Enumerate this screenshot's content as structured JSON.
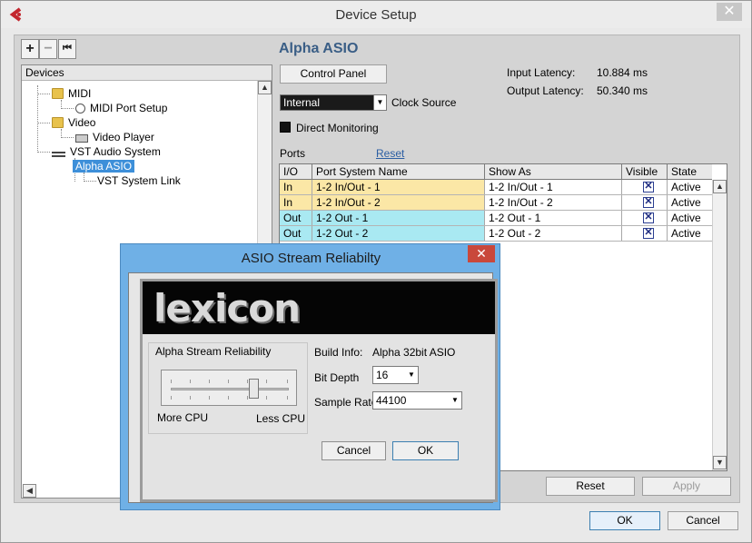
{
  "window": {
    "title": "Device Setup",
    "close_glyph": "✕"
  },
  "toolbar": {
    "add": "+",
    "remove": "−",
    "reset": "⏮"
  },
  "tree": {
    "header": "Devices",
    "items": [
      "MIDI",
      "MIDI Port Setup",
      "Video",
      "Video Player",
      "VST Audio System",
      "Alpha ASIO",
      "VST System Link"
    ]
  },
  "panel": {
    "title": "Alpha ASIO",
    "control_panel": "Control Panel",
    "clock_value": "Internal",
    "clock_label": "Clock Source",
    "direct_monitoring": "Direct Monitoring",
    "input_latency_label": "Input Latency:",
    "input_latency_value": "10.884 ms",
    "output_latency_label": "Output Latency:",
    "output_latency_value": "50.340 ms",
    "ports_label": "Ports",
    "reset_link": "Reset"
  },
  "ports": {
    "headers": [
      "I/O",
      "Port System Name",
      "Show As",
      "Visible",
      "State"
    ],
    "rows": [
      {
        "io": "In",
        "name": "1-2 In/Out - 1",
        "show_as": "1-2 In/Out - 1",
        "visible": "✕",
        "state": "Active"
      },
      {
        "io": "In",
        "name": "1-2 In/Out - 2",
        "show_as": "1-2 In/Out - 2",
        "visible": "✕",
        "state": "Active"
      },
      {
        "io": "Out",
        "name": "1-2 Out - 1",
        "show_as": "1-2 Out - 1",
        "visible": "✕",
        "state": "Active"
      },
      {
        "io": "Out",
        "name": "1-2 Out - 2",
        "show_as": "1-2 Out - 2",
        "visible": "✕",
        "state": "Active"
      }
    ],
    "colors": {
      "in": "#fbe7a6",
      "out": "#a9e9f2"
    }
  },
  "footer": {
    "reset": "Reset",
    "apply": "Apply",
    "ok": "OK",
    "cancel": "Cancel"
  },
  "modal": {
    "title": "ASIO Stream Reliabilty",
    "close_glyph": "✕",
    "logo": "lexicon",
    "group_title": "Alpha Stream Reliability",
    "more_cpu": "More CPU",
    "less_cpu": "Less CPU",
    "slider_level": 0.7,
    "build_info_label": "Build Info:",
    "build_info_value": "Alpha 32bit ASIO",
    "bit_depth_label": "Bit Depth",
    "bit_depth_value": "16",
    "sample_rate_label": "Sample Rate",
    "sample_rate_value": "44100",
    "cancel": "Cancel",
    "ok": "OK"
  }
}
